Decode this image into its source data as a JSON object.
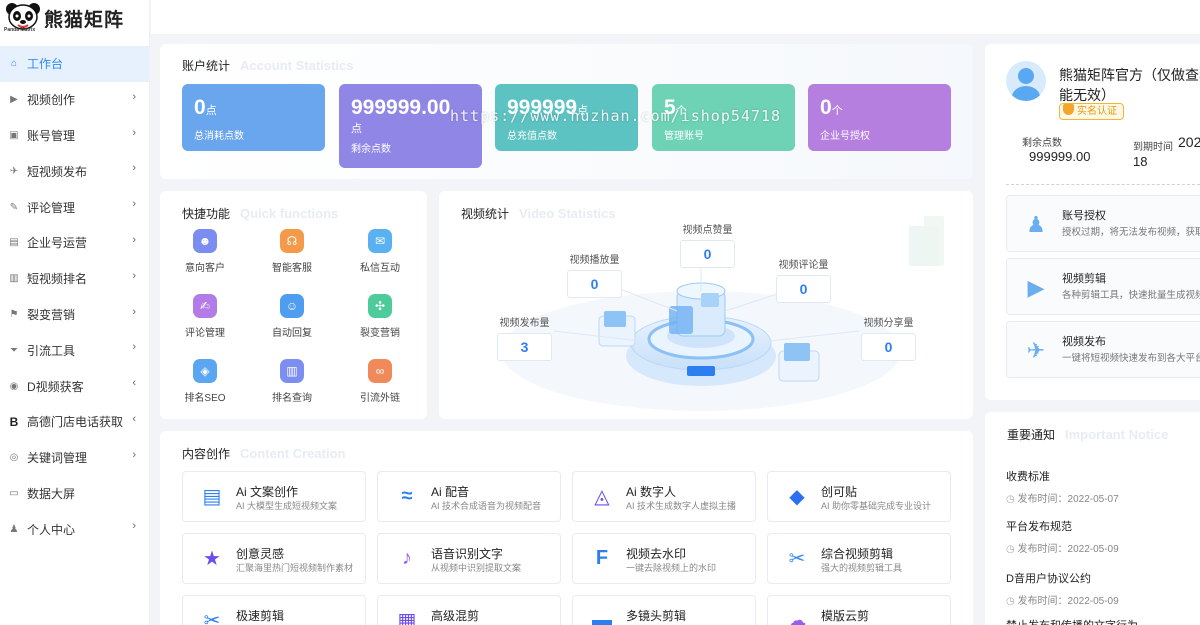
{
  "logo": {
    "text": "熊猫矩阵",
    "sub": "Panda Matrix"
  },
  "sidebar": {
    "items": [
      {
        "label": "工作台",
        "icon": "home-icon",
        "arrow": ""
      },
      {
        "label": "视频创作",
        "icon": "video-icon",
        "arrow": "›"
      },
      {
        "label": "账号管理",
        "icon": "account-icon",
        "arrow": "›"
      },
      {
        "label": "短视频发布",
        "icon": "send-icon",
        "arrow": "›"
      },
      {
        "label": "评论管理",
        "icon": "edit-icon",
        "arrow": "›"
      },
      {
        "label": "企业号运营",
        "icon": "monitor-icon",
        "arrow": "›"
      },
      {
        "label": "短视频排名",
        "icon": "bar-chart-icon",
        "arrow": "›"
      },
      {
        "label": "裂变营销",
        "icon": "share-icon",
        "arrow": "›"
      },
      {
        "label": "引流工具",
        "icon": "funnel-icon",
        "arrow": "›"
      },
      {
        "label": "D视频获客",
        "icon": "eye-icon",
        "arrow": "‹"
      },
      {
        "label": "高德门店电话获取",
        "icon": "b-icon",
        "arrow": "‹"
      },
      {
        "label": "关键词管理",
        "icon": "target-icon",
        "arrow": "›"
      },
      {
        "label": "数据大屏",
        "icon": "screen-icon",
        "arrow": ""
      },
      {
        "label": "个人中心",
        "icon": "user-icon",
        "arrow": "›"
      }
    ]
  },
  "account": {
    "title": "账户统计",
    "title_en": "Account Statistics",
    "stats": [
      {
        "num": "0",
        "unit": "点",
        "label": "总消耗点数",
        "color": "#6aa6ee"
      },
      {
        "num": "999999.00",
        "unit": "点",
        "label": "剩余点数",
        "color": "#8f86e6"
      },
      {
        "num": "999999",
        "unit": "点",
        "label": "总充值点数",
        "color": "#5cc2c2"
      },
      {
        "num": "5",
        "unit": "个",
        "label": "管理账号",
        "color": "#6dd3b4"
      },
      {
        "num": "0",
        "unit": "个",
        "label": "企业号授权",
        "color": "#b57fe0"
      }
    ],
    "watermark": "https://www.huzhan.com/ishop54718"
  },
  "quick": {
    "title": "快捷功能",
    "title_en": "Quick functions",
    "items": [
      {
        "label": "意向客户",
        "icon": "people-icon",
        "color": "#7b8df0"
      },
      {
        "label": "智能客服",
        "icon": "headset-icon",
        "color": "#f59a4a"
      },
      {
        "label": "私信互动",
        "icon": "mail-icon",
        "color": "#5ab1f2"
      },
      {
        "label": "评论管理",
        "icon": "comment-icon",
        "color": "#b27be8"
      },
      {
        "label": "自动回复",
        "icon": "robot-icon",
        "color": "#4f9df0"
      },
      {
        "label": "裂变营销",
        "icon": "network-icon",
        "color": "#4ecb9a"
      },
      {
        "label": "排名SEO",
        "icon": "seo-icon",
        "color": "#5aa6f0"
      },
      {
        "label": "排名查询",
        "icon": "rank-icon",
        "color": "#7c8ef0"
      },
      {
        "label": "引流外链",
        "icon": "link-icon",
        "color": "#f08a5a"
      }
    ]
  },
  "video": {
    "title": "视频统计",
    "title_en": "Video Statistics",
    "stats": [
      {
        "label": "视频点赞量",
        "value": "0"
      },
      {
        "label": "视频播放量",
        "value": "0"
      },
      {
        "label": "视频评论量",
        "value": "0"
      },
      {
        "label": "视频发布量",
        "value": "3"
      },
      {
        "label": "视频分享量",
        "value": "0"
      }
    ]
  },
  "content": {
    "title": "内容创作",
    "title_en": "Content Creation",
    "items": [
      {
        "title": "Ai 文案创作",
        "desc": "AI 大模型生成短视频文案",
        "icon": "doc-icon",
        "color": "#2d7ff0"
      },
      {
        "title": "Ai 配音",
        "desc": "AI 技术合成语音为视频配音",
        "icon": "voice-icon",
        "color": "#2d7ff0"
      },
      {
        "title": "Ai 数字人",
        "desc": "AI 技术生成数字人虚拟主播",
        "icon": "digital-human-icon",
        "color": "#6a4cf0"
      },
      {
        "title": "创可贴",
        "desc": "AI 助你零基础完成专业设计",
        "icon": "design-icon",
        "color": "#2d6ef0"
      },
      {
        "title": "创意灵感",
        "desc": "汇聚海里热门短视频制作素材",
        "icon": "star-icon",
        "color": "#6a4cf0"
      },
      {
        "title": "语音识别文字",
        "desc": "从视频中识别提取文案",
        "icon": "mic-icon",
        "color": "#9b5cf0"
      },
      {
        "title": "视频去水印",
        "desc": "一键去除视频上的水印",
        "icon": "watermark-icon",
        "color": "#2d7ff0"
      },
      {
        "title": "综合视频剪辑",
        "desc": "强大的视频剪辑工具",
        "icon": "scissors-icon",
        "color": "#3a8af0"
      },
      {
        "title": "极速剪辑",
        "desc": "",
        "icon": "fast-cut-icon",
        "color": "#2d7ff0"
      },
      {
        "title": "高级混剪",
        "desc": "",
        "icon": "mix-icon",
        "color": "#6a4cf0"
      },
      {
        "title": "多镜头剪辑",
        "desc": "",
        "icon": "clapper-icon",
        "color": "#2d7ff0"
      },
      {
        "title": "模版云剪",
        "desc": "",
        "icon": "cloud-cut-icon",
        "color": "#9b5cf0"
      }
    ]
  },
  "profile": {
    "name": "熊猫矩阵官方（仅做查看",
    "name2": "能无效）",
    "badge": "实名认证",
    "remaining_label": "剩余点数",
    "remaining_value": "999999.00",
    "expire_label": "到期时间",
    "expire_value": "202",
    "expire_value2": "18"
  },
  "services": [
    {
      "title": "账号授权",
      "desc": "授权过期，将无法发布视频，获取",
      "icon": "auth-icon"
    },
    {
      "title": "视频剪辑",
      "desc": "各种剪辑工具，快速批量生成视频",
      "icon": "clip-icon"
    },
    {
      "title": "视频发布",
      "desc": "一键将短视频快速发布到各大平台",
      "icon": "paper-plane-icon"
    }
  ],
  "notices": {
    "title": "重要通知",
    "title_en": "Important Notice",
    "items": [
      {
        "title": "收费标准",
        "time": "发布时间：2022-05-07"
      },
      {
        "title": "平台发布规范",
        "time": "发布时间：2022-05-09"
      },
      {
        "title": "D音用户协议公约",
        "time": "发布时间：2022-05-09"
      },
      {
        "title": "禁止发布和传播的文字行为",
        "time": ""
      }
    ]
  }
}
